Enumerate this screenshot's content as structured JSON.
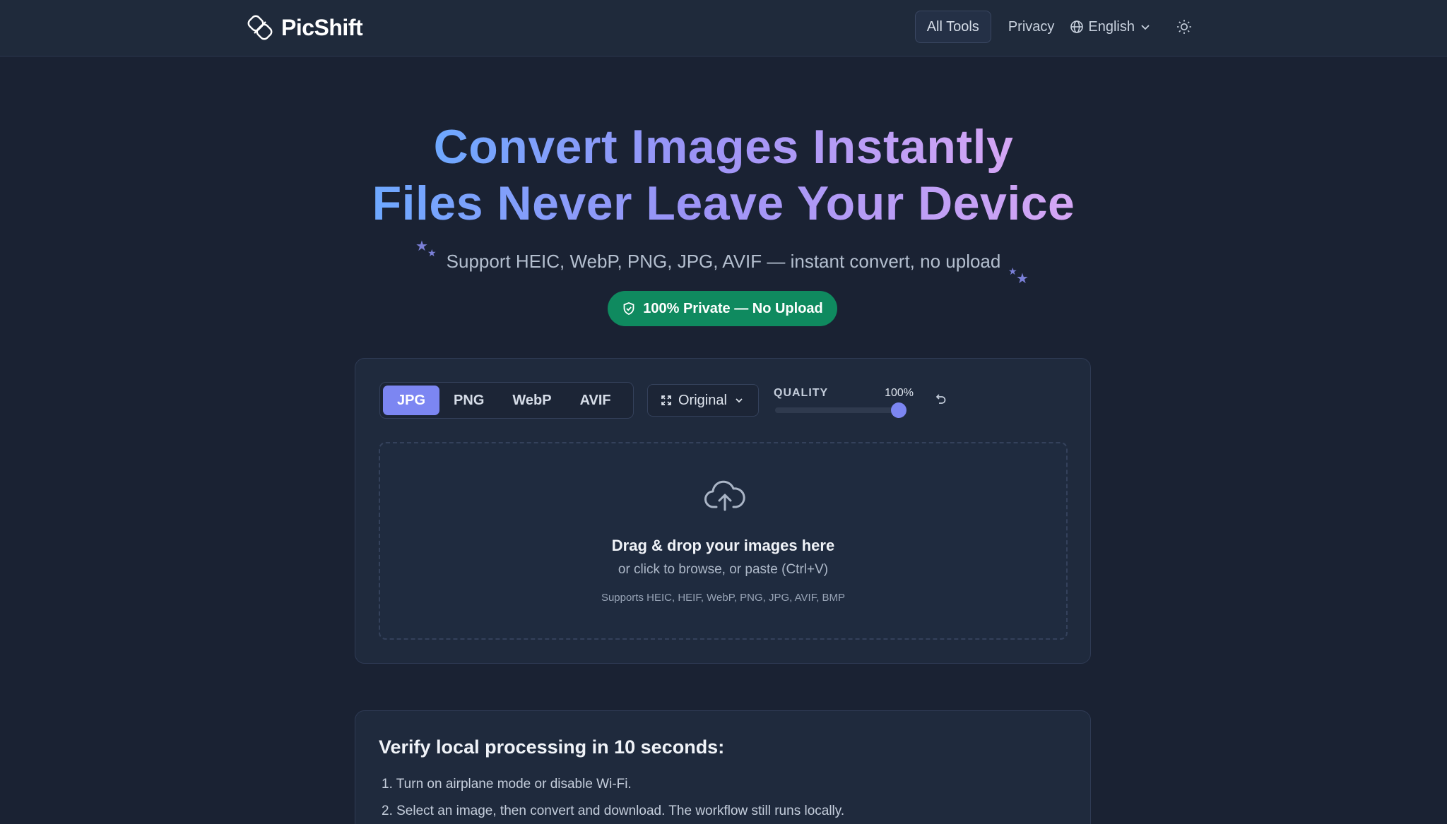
{
  "header": {
    "brand_name": "PicShift",
    "nav": {
      "all_tools": "All Tools",
      "privacy": "Privacy",
      "language": "English"
    }
  },
  "hero": {
    "title_line1": "Convert Images Instantly",
    "title_line2": "Files Never Leave Your Device",
    "subtitle": "Support HEIC, WebP, PNG, JPG, AVIF — instant convert, no upload",
    "badge": "100% Private — No Upload"
  },
  "converter": {
    "formats": [
      "JPG",
      "PNG",
      "WebP",
      "AVIF"
    ],
    "selected_format": "JPG",
    "size_option": "Original",
    "quality_label": "QUALITY",
    "quality_display": "100%",
    "quality_percent": 100,
    "dropzone": {
      "title": "Drag & drop your images here",
      "subtitle": "or click to browse, or paste (Ctrl+V)",
      "supported": "Supports HEIC, HEIF, WebP, PNG, JPG, AVIF, BMP"
    }
  },
  "verify": {
    "title": "Verify local processing in 10 seconds:",
    "steps": [
      "1. Turn on airplane mode or disable Wi-Fi.",
      "2. Select an image, then convert and download. The workflow still runs locally."
    ]
  },
  "colors": {
    "background": "#1a2233",
    "accent": "#7c86f2",
    "private_badge": "#0f8a5f",
    "title_gradient_start": "#6ea8ff",
    "title_gradient_end": "#d5a6f5"
  },
  "icons": {
    "brand": "shift-logo-icon",
    "language": "globe-icon",
    "theme": "sun-icon",
    "badge": "shield-check-icon",
    "size": "expand-icon",
    "reset": "undo-icon",
    "dropzone": "cloud-upload-icon"
  }
}
